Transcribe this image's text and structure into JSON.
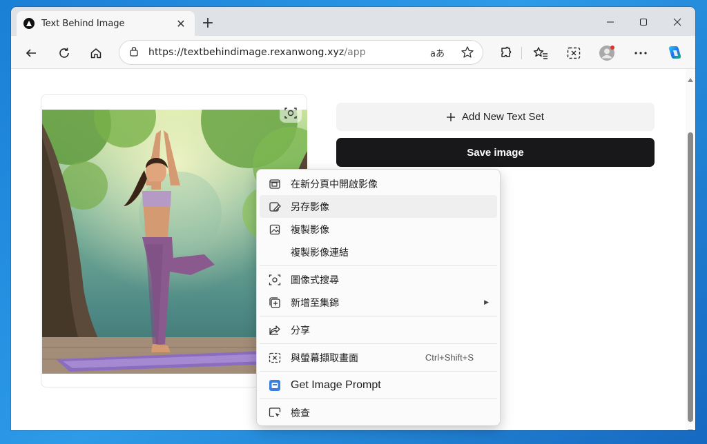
{
  "tab": {
    "title": "Text Behind Image",
    "close_glyph": "✕"
  },
  "new_tab_glyph": "+",
  "address_bar": {
    "url_host": "https://textbehindimage.rexanwong.xyz",
    "url_path": "/app",
    "read_aloud_icon": "aあ"
  },
  "app": {
    "add_text_set_label": "Add New Text Set",
    "save_image_label": "Save image"
  },
  "context_menu": {
    "items": [
      {
        "label": "在新分頁中開啟影像",
        "icon": "open-new-tab-icon"
      },
      {
        "label": "另存影像",
        "icon": "save-image-icon",
        "highlighted": true
      },
      {
        "label": "複製影像",
        "icon": "copy-image-icon"
      },
      {
        "label": "複製影像連結",
        "icon": ""
      },
      {
        "label": "圖像式搜尋",
        "icon": "visual-search-icon"
      },
      {
        "label": "新增至集錦",
        "icon": "add-collection-icon",
        "submenu": true
      },
      {
        "label": "分享",
        "icon": "share-icon"
      },
      {
        "label": "與螢幕擷取畫面",
        "icon": "screenshot-icon",
        "shortcut": "Ctrl+Shift+S"
      },
      {
        "label": "Get Image Prompt",
        "icon": "extension-icon"
      },
      {
        "label": "檢查",
        "icon": "inspect-icon"
      }
    ]
  },
  "colors": {
    "save_button_bg": "#18181b",
    "add_button_bg": "#f3f3f3",
    "accent": "#1a7fd6"
  }
}
